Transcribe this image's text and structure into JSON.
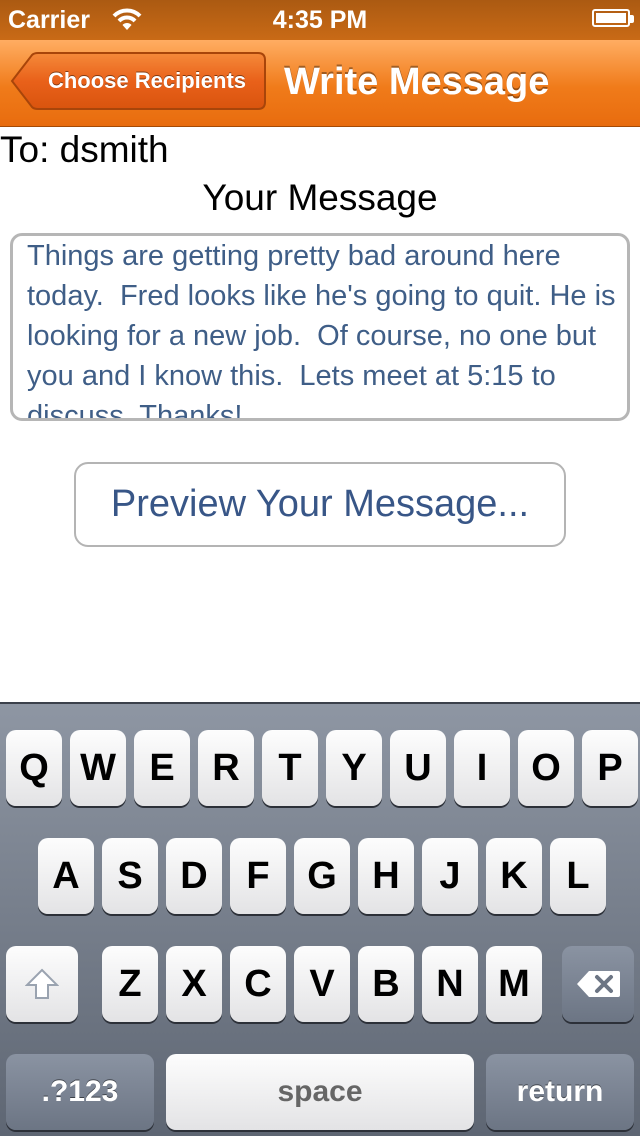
{
  "status_bar": {
    "carrier": "Carrier",
    "time": "4:35 PM",
    "wifi_icon": "wifi-icon",
    "battery_icon": "battery-icon"
  },
  "nav": {
    "back_label": "Choose Recipients",
    "title": "Write Message",
    "color": "#f07b1a"
  },
  "recipient": {
    "label": "To: dsmith"
  },
  "message": {
    "heading": "Your Message",
    "body": "Things are getting pretty bad around here today.  Fred looks like he's going to quit. He is looking for a new job.  Of course, no one but you and I know this.  Lets meet at 5:15 to discuss. Thanks!",
    "text_color": "#3f5e87"
  },
  "preview_button": {
    "label": "Preview Your Message..."
  },
  "keyboard": {
    "row1": [
      "Q",
      "W",
      "E",
      "R",
      "T",
      "Y",
      "U",
      "I",
      "O",
      "P"
    ],
    "row2": [
      "A",
      "S",
      "D",
      "F",
      "G",
      "H",
      "J",
      "K",
      "L"
    ],
    "row3": [
      "Z",
      "X",
      "C",
      "V",
      "B",
      "N",
      "M"
    ],
    "shift_icon": "shift-icon",
    "delete_icon": "delete-icon",
    "numbers_label": ".?123",
    "space_label": "space",
    "return_label": "return"
  }
}
